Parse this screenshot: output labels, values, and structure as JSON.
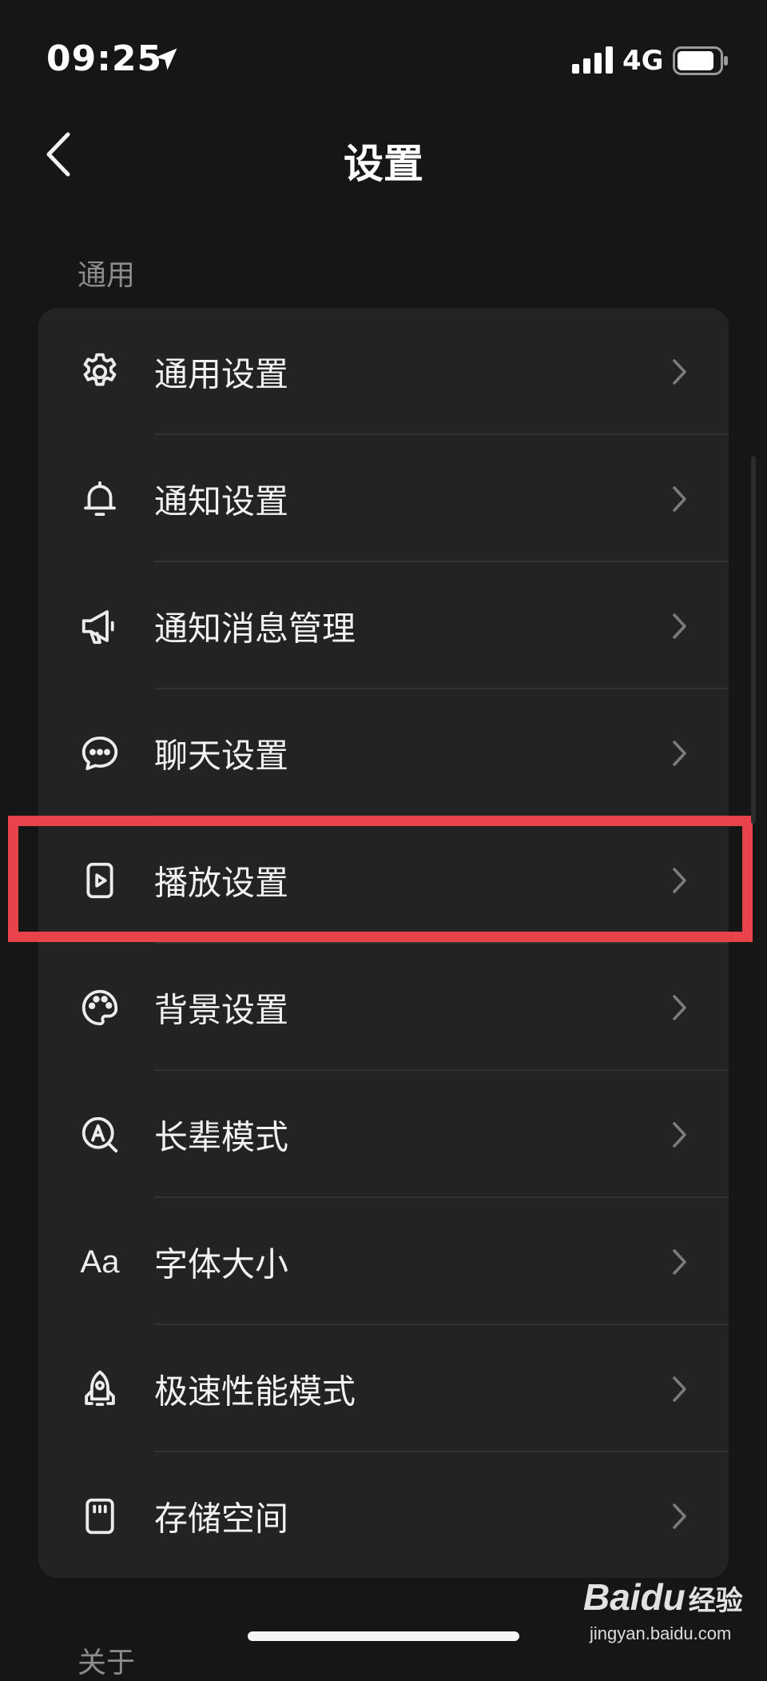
{
  "status_bar": {
    "time": "09:25",
    "network": "4G",
    "icons": [
      "location-arrow-icon",
      "signal-bars-icon",
      "battery-icon"
    ]
  },
  "nav": {
    "back_icon": "chevron-left-icon",
    "title": "设置"
  },
  "section": {
    "header": "通用",
    "items": [
      {
        "label": "通用设置",
        "icon": "gear-icon"
      },
      {
        "label": "通知设置",
        "icon": "bell-icon"
      },
      {
        "label": "通知消息管理",
        "icon": "megaphone-icon"
      },
      {
        "label": "聊天设置",
        "icon": "chat-bubble-icon"
      },
      {
        "label": "播放设置",
        "icon": "play-icon",
        "highlighted": true
      },
      {
        "label": "背景设置",
        "icon": "palette-icon"
      },
      {
        "label": "长辈模式",
        "icon": "elder-mode-icon"
      },
      {
        "label": "字体大小",
        "icon": "font-size-icon",
        "glyph": "Aa"
      },
      {
        "label": "极速性能模式",
        "icon": "rocket-icon"
      },
      {
        "label": "存储空间",
        "icon": "storage-card-icon"
      }
    ]
  },
  "next_section": {
    "header": "关于"
  },
  "watermark": {
    "logo": "Baidu",
    "suffix": "经验",
    "url": "jingyan.baidu.com"
  },
  "colors": {
    "background": "#161616",
    "card": "#232323",
    "divider": "#323232",
    "highlight": "#e8434a",
    "section_header": "#8c8c8c"
  }
}
